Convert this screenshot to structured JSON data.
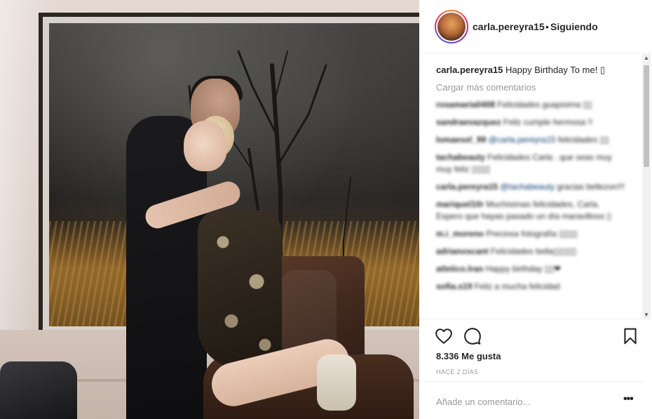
{
  "post": {
    "username": "carla.pereyra15",
    "separator": "•",
    "follow_status": "Siguiendo",
    "caption_user": "carla.pereyra15",
    "caption_text": "Happy Birthday To me! ▯",
    "load_more": "Cargar más comentarios",
    "likes": "8.336 Me gusta",
    "time_ago": "HACE 2 DÍAS",
    "add_comment_placeholder": "Añade un comentario...",
    "more_options": "•••"
  },
  "comments": [
    {
      "user": "rosamaria0408",
      "text": "Felicidades guapisima ▯▯"
    },
    {
      "user": "sandraevazquez",
      "text": "Feliz cumple hermosa !!"
    },
    {
      "user": "lomaesel_99",
      "mention": "@carla.pereyra15",
      "text": "felicidades ▯▯"
    },
    {
      "user": "tachabeauty",
      "text": "Felicidades Carla . que seas muy muy feliz ▯▯▯▯"
    },
    {
      "user": "carla.pereyra15",
      "mention": "@tachabeauty",
      "text": "gracias bellezon!!!"
    },
    {
      "user": "mariquel10r",
      "text": "Muchisimas felicidades, Carla. Espero que hayas pasado un día maravilloso ▯"
    },
    {
      "user": "m.i_moreno",
      "text": "Preciosa fotografía ▯▯▯▯"
    },
    {
      "user": "adrianoscant",
      "text": "Felicidades bella▯▯▯▯▯"
    },
    {
      "user": "atletico.lran",
      "text": "Happy birthday ▯▯❤"
    },
    {
      "user": "sofia.s19",
      "text": "Feliz a mucha felicidad"
    }
  ],
  "icons": {
    "heart": "heart-icon",
    "comment": "comment-icon",
    "bookmark": "bookmark-icon"
  },
  "colors": {
    "text": "#262626",
    "muted": "#999999",
    "mention": "#003569",
    "divider": "#efefef"
  }
}
